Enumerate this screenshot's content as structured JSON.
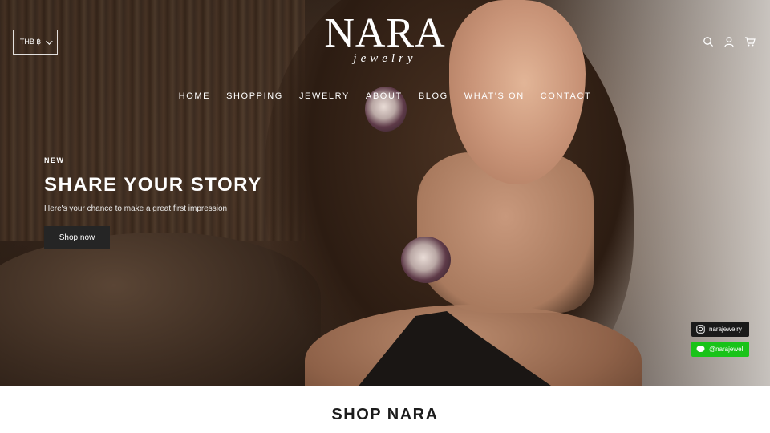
{
  "header": {
    "currency": "THB ฿",
    "logo": {
      "word": "NARA",
      "sub": "jewelry"
    },
    "nav": [
      "HOME",
      "SHOPPING",
      "JEWELRY",
      "ABOUT",
      "BLOG",
      "WHAT'S ON",
      "CONTACT"
    ],
    "icons": [
      "search-icon",
      "account-icon",
      "cart-icon"
    ]
  },
  "hero": {
    "badge": "NEW",
    "headline": "SHARE YOUR STORY",
    "tagline": "Here's your chance to make a great first impression",
    "button": "Shop now"
  },
  "social": {
    "instagram": "narajewelry",
    "line": "@narajewel"
  },
  "section": {
    "title": "SHOP NARA"
  },
  "colors": {
    "line_green": "#19c319",
    "button_dark": "#252525"
  }
}
